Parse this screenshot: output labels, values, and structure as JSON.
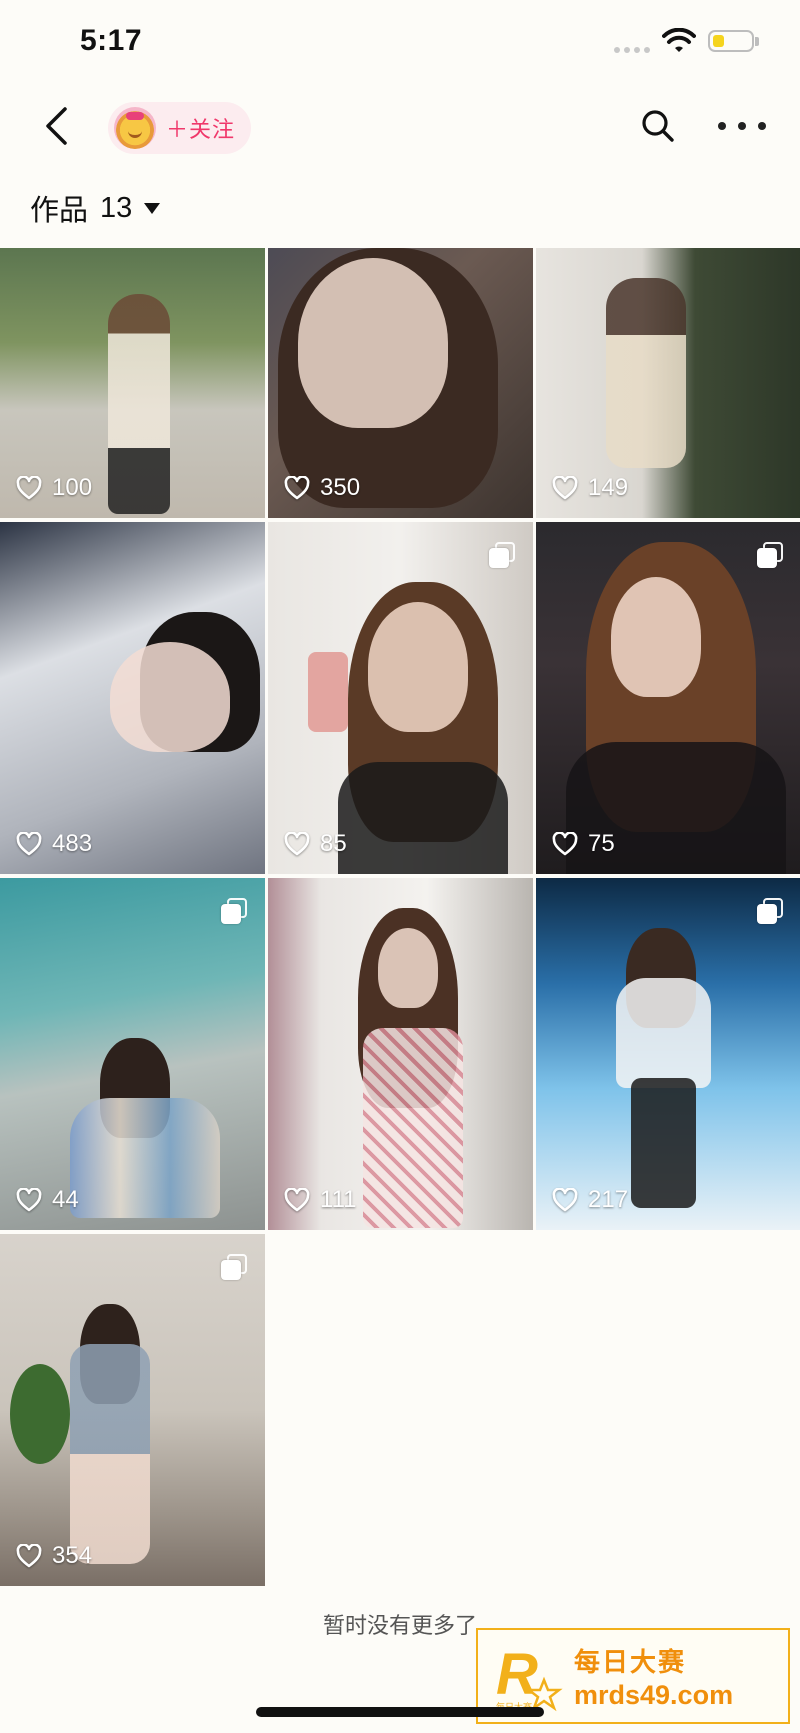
{
  "status_bar": {
    "time": "5:17",
    "battery_level": 0.3,
    "battery_color": "#f5d41e"
  },
  "nav": {
    "back_icon": "chevron-left-icon",
    "follow_label": "＋关注",
    "follow_color": "#f0386b",
    "search_icon": "search-icon",
    "more_icon": "more-dots-icon"
  },
  "works": {
    "label": "作品",
    "count": "13"
  },
  "posts": [
    {
      "likes": "100",
      "multi": false
    },
    {
      "likes": "350",
      "multi": false
    },
    {
      "likes": "149",
      "multi": false
    },
    {
      "likes": "483",
      "multi": false
    },
    {
      "likes": "85",
      "multi": true
    },
    {
      "likes": "75",
      "multi": true
    },
    {
      "likes": "44",
      "multi": true
    },
    {
      "likes": "111",
      "multi": false
    },
    {
      "likes": "217",
      "multi": true
    },
    {
      "likes": "354",
      "multi": true
    }
  ],
  "footer": {
    "no_more_text": "暂时没有更多了"
  },
  "watermark": {
    "logo_letter": "R",
    "logo_caption": "每日大赛",
    "title": "每日大赛",
    "url": "mrds49.com"
  }
}
